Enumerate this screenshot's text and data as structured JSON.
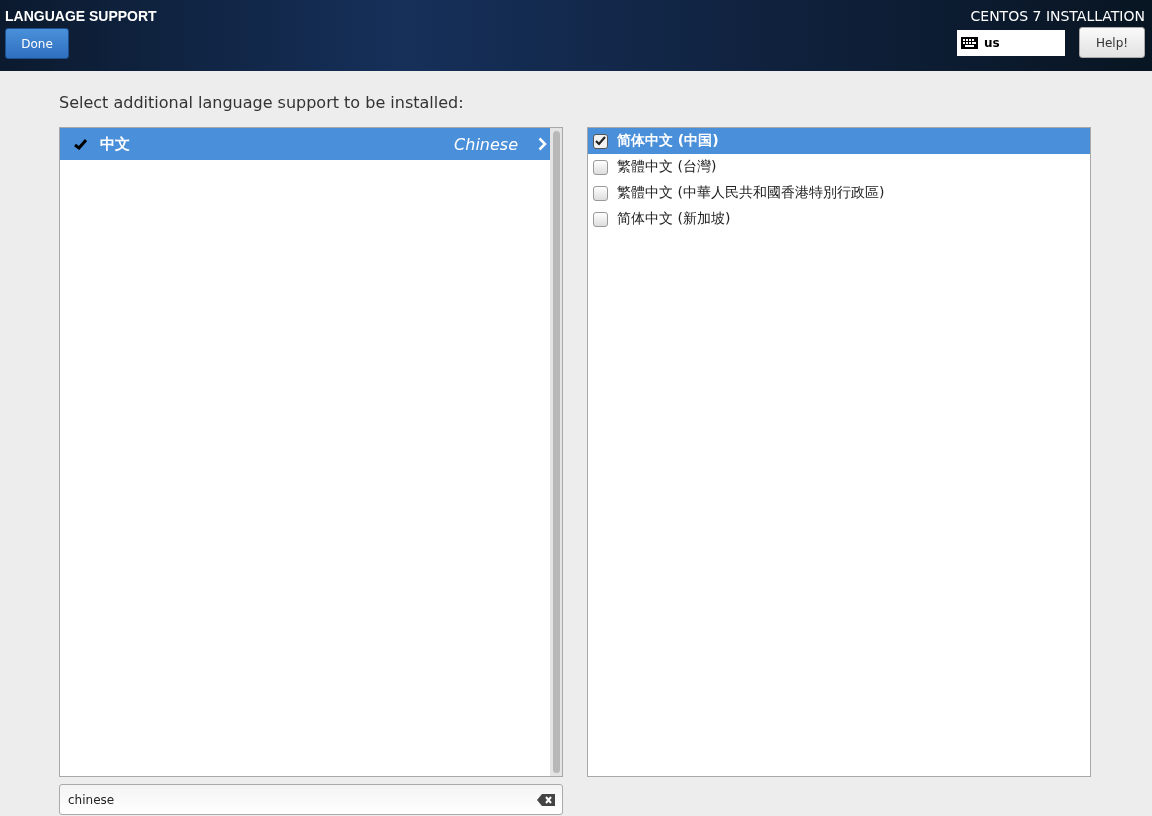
{
  "header": {
    "title": "LANGUAGE SUPPORT",
    "done_button": "Done",
    "product": "CENTOS 7 INSTALLATION",
    "keyboard": "us",
    "help_button": "Help!"
  },
  "prompt": "Select additional language support to be installed:",
  "languages": [
    {
      "native": "中文",
      "english": "Chinese",
      "selected": true,
      "checked": true
    }
  ],
  "locales": [
    {
      "label": "简体中文 (中国)",
      "selected": true,
      "checked": true
    },
    {
      "label": "繁體中文 (台灣)",
      "selected": false,
      "checked": false
    },
    {
      "label": "繁體中文 (中華人民共和國香港特別行政區)",
      "selected": false,
      "checked": false
    },
    {
      "label": "简体中文 (新加坡)",
      "selected": false,
      "checked": false
    }
  ],
  "search": {
    "value": "chinese"
  }
}
